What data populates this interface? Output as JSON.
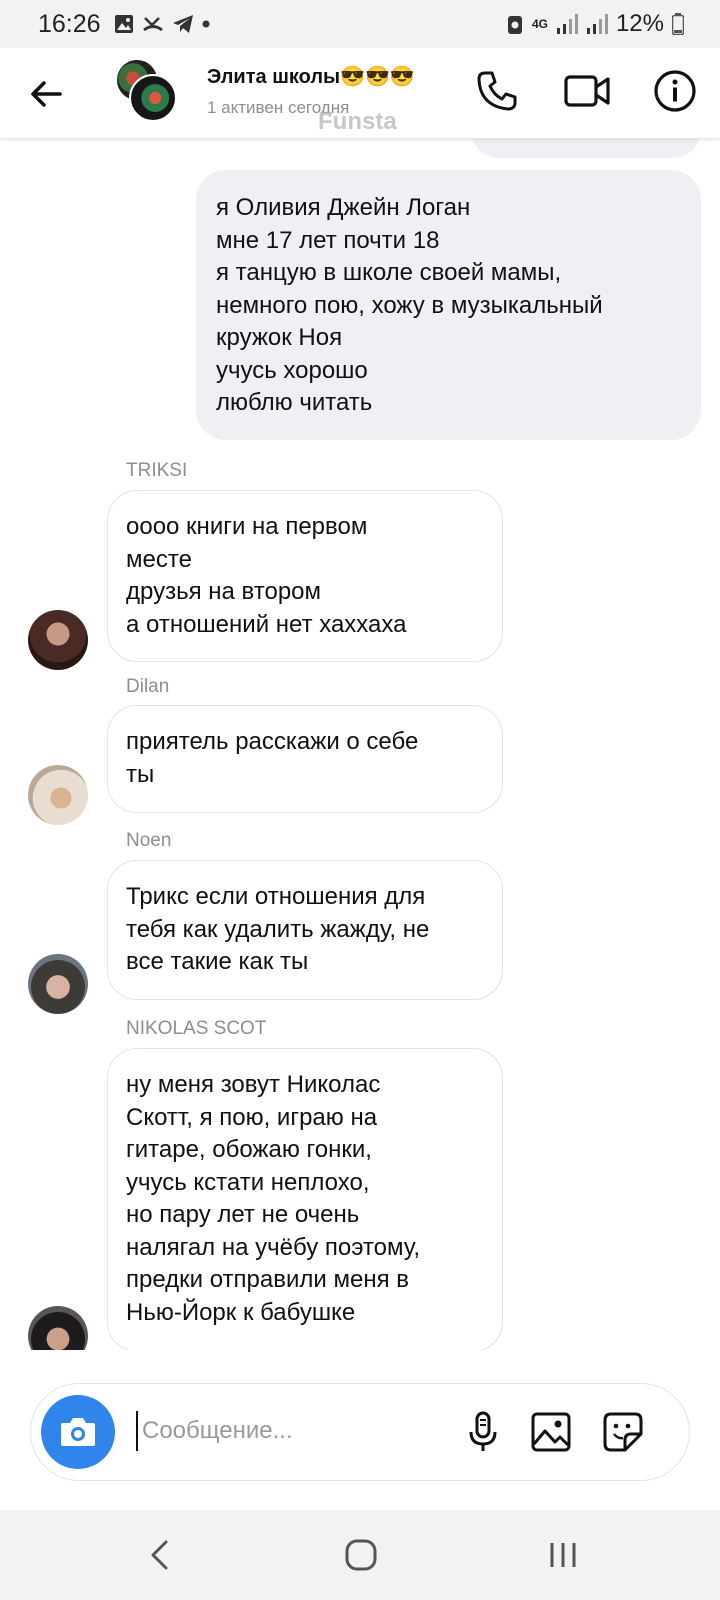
{
  "status_bar": {
    "time": "16:26",
    "network": "4G",
    "battery": "12%"
  },
  "header": {
    "title": "Элита школы😎😎😎",
    "subtitle": "1 активен сегодня",
    "watermark": "Funsta",
    "icons": [
      "back-arrow-icon",
      "phone-icon",
      "video-camera-icon",
      "info-icon"
    ]
  },
  "messages": {
    "outgoing_1": {
      "text": "я Оливия Джейн Логан\nмне 17 лет почти 18\nя танцую в школе своей мамы,\nнемного пою, хожу в музыкальный\nкружок Ноя\nучусь хорошо\nлюблю читать"
    },
    "incoming": [
      {
        "sender": "TRIKSI",
        "text": "оооо книги на первом\nместе\nдрузья на втором\nа отношений нет хаххаха"
      },
      {
        "sender": "Dilan",
        "text": "приятель расскажи о себе\nты"
      },
      {
        "sender": "Noen",
        "text": "Трикс если отношения для\nтебя как удалить жажду, не\nвсе такие как ты"
      },
      {
        "sender": "NIKOLAS SCOT",
        "text": "ну меня зовут Николас\nСкотт, я пою, играю на\nгитаре, обожаю гонки,\nучусь кстати неплохо,\nно пару лет не очень\nналягал на учёбу поэтому,\nпредки отправили меня в\nНью-Йорк к бабушке"
      }
    ]
  },
  "composer": {
    "placeholder": "Сообщение...",
    "value": "",
    "icons": [
      "camera-icon",
      "microphone-icon",
      "gallery-icon",
      "sticker-icon"
    ],
    "camera_color": "#2f85ec"
  },
  "colors": {
    "outgoing_bubble": "#efeff4",
    "incoming_border": "#e3e3e3",
    "sender_label": "#8e8e8e"
  },
  "navbar": {
    "icons": [
      "nav-back-icon",
      "nav-home-icon",
      "nav-recents-icon"
    ]
  }
}
